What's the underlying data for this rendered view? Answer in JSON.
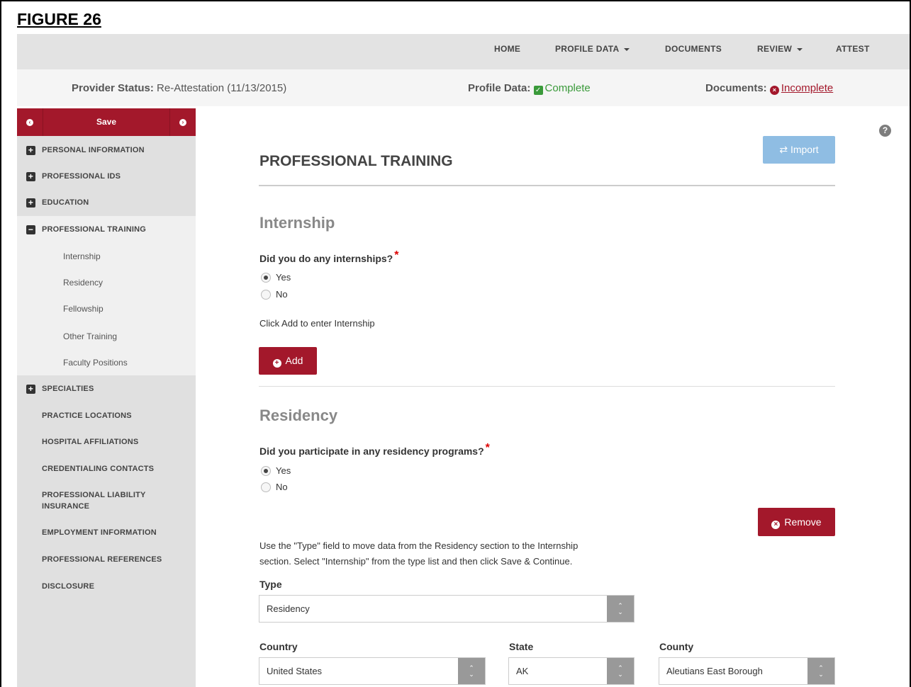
{
  "figure_label": "FIGURE 26",
  "topnav": {
    "home": "HOME",
    "profile_data": "PROFILE DATA",
    "documents": "DOCUMENTS",
    "review": "REVIEW",
    "attest": "ATTEST"
  },
  "status": {
    "provider_label": "Provider Status:",
    "provider_value": "Re-Attestation (11/13/2015)",
    "profile_label": "Profile Data:",
    "profile_value": "Complete",
    "documents_label": "Documents:",
    "documents_value": "Incomplete"
  },
  "sidebar": {
    "save_label": "Save",
    "items": {
      "personal": "PERSONAL INFORMATION",
      "professional_ids": "PROFESSIONAL IDS",
      "education": "EDUCATION",
      "professional_training": "PROFESSIONAL TRAINING",
      "specialties": "SPECIALTIES",
      "practice_locations": "PRACTICE LOCATIONS",
      "hospital_affiliations": "HOSPITAL AFFILIATIONS",
      "credentialing_contacts": "CREDENTIALING CONTACTS",
      "liability_line1": "PROFESSIONAL LIABILITY",
      "liability_line2": "INSURANCE",
      "employment": "EMPLOYMENT INFORMATION",
      "references": "PROFESSIONAL REFERENCES",
      "disclosure": "DISCLOSURE"
    },
    "subitems": {
      "internship": "Internship",
      "residency": "Residency",
      "fellowship": "Fellowship",
      "other_training": "Other Training",
      "faculty_positions": "Faculty Positions"
    }
  },
  "main": {
    "page_title": "PROFESSIONAL TRAINING",
    "import_label": "Import",
    "internship": {
      "title": "Internship",
      "question": "Did you do any internships?",
      "yes": "Yes",
      "no": "No",
      "selected": "Yes",
      "hint": "Click Add to enter Internship",
      "add_label": "Add"
    },
    "residency": {
      "title": "Residency",
      "question": "Did you participate in any residency programs?",
      "yes": "Yes",
      "no": "No",
      "selected": "Yes",
      "remove_label": "Remove",
      "note_line1": "Use the \"Type\" field to move data from the Residency section to the Internship",
      "note_line2": "section. Select \"Internship\" from the type list and then click Save & Continue.",
      "type_label": "Type",
      "type_value": "Residency",
      "country_label": "Country",
      "country_value": "United States",
      "state_label": "State",
      "state_value": "AK",
      "county_label": "County",
      "county_value": "Aleutians East Borough"
    }
  },
  "colors": {
    "brand_red": "#a3182b",
    "import_blue": "#8fbde3",
    "complete_green": "#3a9a3a"
  },
  "icons": [
    "expand-plus-icon",
    "collapse-minus-icon",
    "prev-arrow-icon",
    "next-arrow-icon",
    "help-icon",
    "swap-arrows-icon",
    "plus-circle-icon",
    "remove-circle-icon",
    "check-box-icon",
    "error-circle-icon",
    "spinner-arrows-icon"
  ]
}
